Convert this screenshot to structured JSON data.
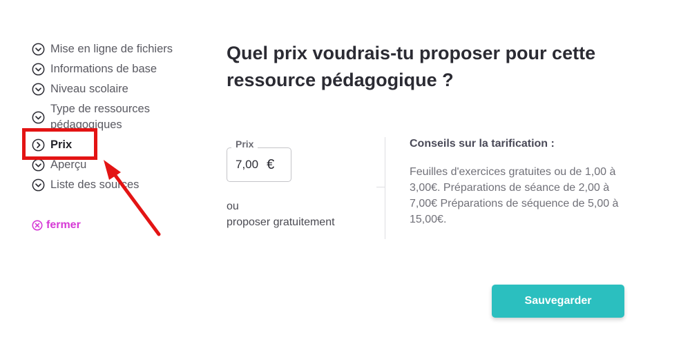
{
  "sidebar": {
    "steps": [
      {
        "label": "Mise en ligne de fichiers",
        "icon": "check-circle-icon",
        "state": "done"
      },
      {
        "label": "Informations de base",
        "icon": "check-circle-icon",
        "state": "done"
      },
      {
        "label": "Niveau scolaire",
        "icon": "check-circle-icon",
        "state": "done"
      },
      {
        "label": "Type de ressources pédagogiques",
        "icon": "check-circle-icon",
        "state": "done"
      },
      {
        "label": "Prix",
        "icon": "chevron-right-circle-icon",
        "state": "active"
      },
      {
        "label": "Aperçu",
        "icon": "check-circle-icon",
        "state": "done"
      },
      {
        "label": "Liste des sources",
        "icon": "check-circle-icon",
        "state": "done"
      }
    ],
    "close_label": "fermer",
    "close_icon": "close-circle-icon"
  },
  "main": {
    "title": "Quel prix voudrais-tu proposer pour cette ressource pédagogique ?",
    "price": {
      "legend": "Prix",
      "value": "7,00",
      "currency": "€"
    },
    "or_label": "ou",
    "free_label": "proposer gratuitement",
    "tips": {
      "title": "Conseils sur la tarification :",
      "body": "Feuilles d'exercices gratuites ou de 1,00 à 3,00€. Préparations de séance de 2,00 à 7,00€ Préparations de séquence de 5,00 à 15,00€."
    },
    "save_label": "Sauvegarder"
  },
  "colors": {
    "accent": "#2bbfbf",
    "close_link": "#d63ad6",
    "annotation": "#e31414",
    "text": "#4a4a52"
  }
}
